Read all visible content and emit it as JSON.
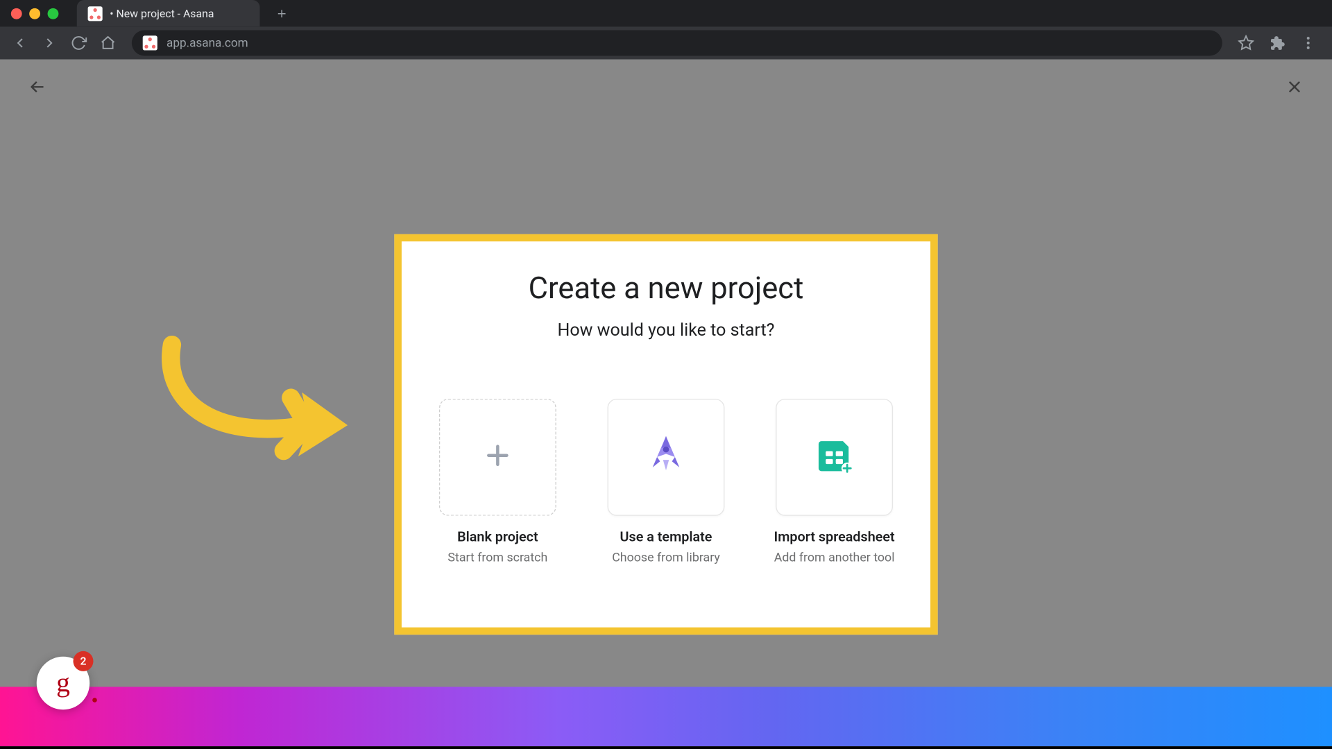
{
  "browser": {
    "tab_title": "• New project - Asana",
    "url": "app.asana.com"
  },
  "modal": {
    "title": "Create a new project",
    "subtitle": "How would you like to start?",
    "options": [
      {
        "title": "Blank project",
        "subtitle": "Start from scratch"
      },
      {
        "title": "Use a template",
        "subtitle": "Choose from library"
      },
      {
        "title": "Import spreadsheet",
        "subtitle": "Add from another tool"
      }
    ]
  },
  "bubble": {
    "letter": "g",
    "badge_count": "2"
  },
  "annotation": {
    "highlight_color": "#f4c430",
    "arrow_color": "#f4c430"
  }
}
